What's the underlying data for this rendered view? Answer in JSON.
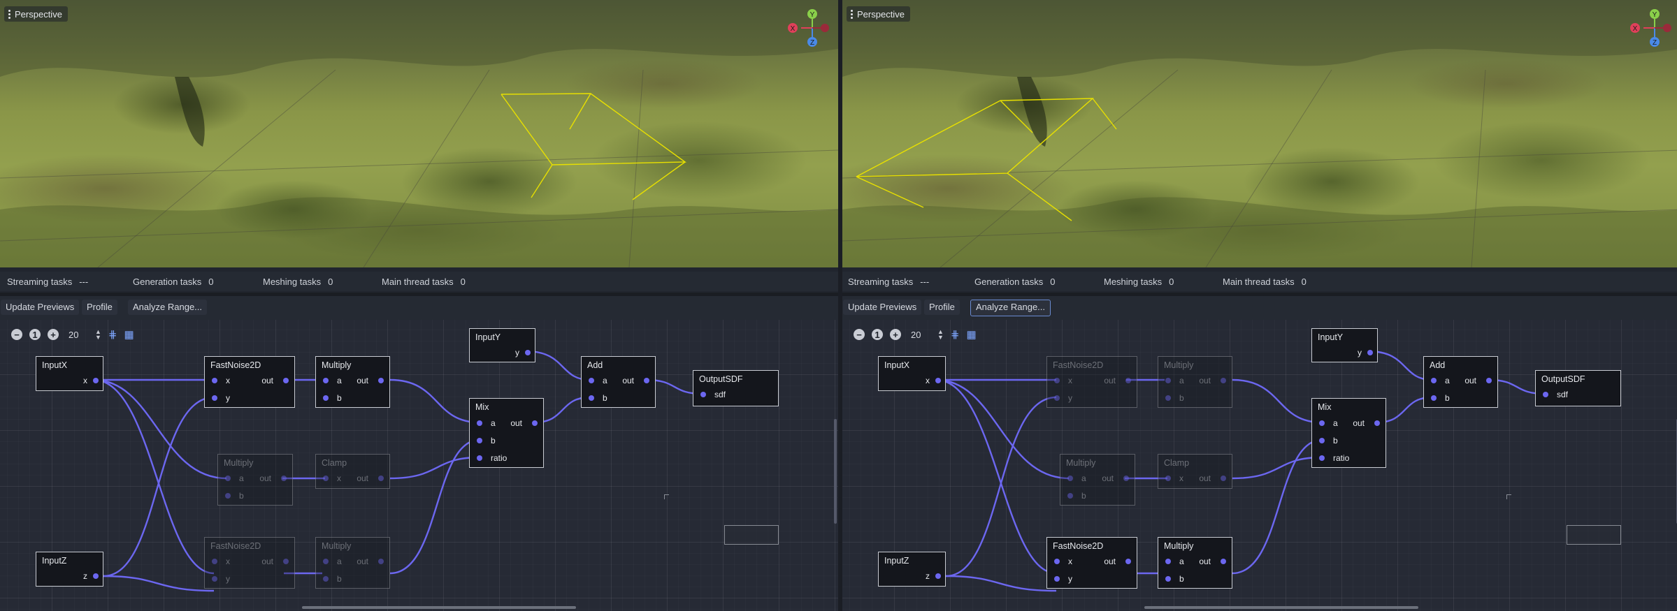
{
  "panels": [
    {
      "viewport": {
        "view_label": "Perspective",
        "gizmo": {
          "x": "X",
          "y": "Y",
          "z": "Z"
        }
      },
      "stats": [
        {
          "label": "Streaming tasks",
          "value": "---"
        },
        {
          "label": "Generation tasks",
          "value": "0"
        },
        {
          "label": "Meshing tasks",
          "value": "0"
        },
        {
          "label": "Main thread tasks",
          "value": "0"
        }
      ],
      "toolbar": {
        "update_previews": "Update Previews",
        "profile": "Profile",
        "analyze_range": "Analyze Range..."
      },
      "zoom": {
        "minus": "−",
        "one": "1",
        "plus": "+",
        "value": "20"
      },
      "nodes": {
        "inputx": {
          "title": "InputX",
          "out": "x"
        },
        "inputz": {
          "title": "InputZ",
          "out": "z"
        },
        "inputy": {
          "title": "InputY",
          "out": "y"
        },
        "noise1": {
          "title": "FastNoise2D",
          "in1": "x",
          "in2": "y",
          "out": "out"
        },
        "mul1": {
          "title": "Multiply",
          "in1": "a",
          "in2": "b",
          "out": "out"
        },
        "mul2": {
          "title": "Multiply",
          "in1": "a",
          "in2": "b",
          "out": "out"
        },
        "clamp": {
          "title": "Clamp",
          "in1": "x",
          "out": "out"
        },
        "noise2": {
          "title": "FastNoise2D",
          "in1": "x",
          "in2": "y",
          "out": "out"
        },
        "mul3": {
          "title": "Multiply",
          "in1": "a",
          "in2": "b",
          "out": "out"
        },
        "mix": {
          "title": "Mix",
          "in1": "a",
          "in2": "b",
          "in3": "ratio",
          "out": "out"
        },
        "add": {
          "title": "Add",
          "in1": "a",
          "in2": "b",
          "out": "out"
        },
        "output": {
          "title": "OutputSDF",
          "in1": "sdf"
        }
      }
    },
    {
      "viewport": {
        "view_label": "Perspective",
        "gizmo": {
          "x": "X",
          "y": "Y",
          "z": "Z"
        }
      },
      "stats": [
        {
          "label": "Streaming tasks",
          "value": "---"
        },
        {
          "label": "Generation tasks",
          "value": "0"
        },
        {
          "label": "Meshing tasks",
          "value": "0"
        },
        {
          "label": "Main thread tasks",
          "value": "0"
        }
      ],
      "toolbar": {
        "update_previews": "Update Previews",
        "profile": "Profile",
        "analyze_range": "Analyze Range..."
      },
      "zoom": {
        "minus": "−",
        "one": "1",
        "plus": "+",
        "value": "20"
      },
      "nodes": {
        "inputx": {
          "title": "InputX",
          "out": "x"
        },
        "inputz": {
          "title": "InputZ",
          "out": "z"
        },
        "inputy": {
          "title": "InputY",
          "out": "y"
        },
        "noise1": {
          "title": "FastNoise2D",
          "in1": "x",
          "in2": "y",
          "out": "out"
        },
        "mul1": {
          "title": "Multiply",
          "in1": "a",
          "in2": "b",
          "out": "out"
        },
        "mul2": {
          "title": "Multiply",
          "in1": "a",
          "in2": "b",
          "out": "out"
        },
        "clamp": {
          "title": "Clamp",
          "in1": "x",
          "out": "out"
        },
        "noise2": {
          "title": "FastNoise2D",
          "in1": "x",
          "in2": "y",
          "out": "out"
        },
        "mul3": {
          "title": "Multiply",
          "in1": "a",
          "in2": "b",
          "out": "out"
        },
        "mix": {
          "title": "Mix",
          "in1": "a",
          "in2": "b",
          "in3": "ratio",
          "out": "out"
        },
        "add": {
          "title": "Add",
          "in1": "a",
          "in2": "b",
          "out": "out"
        },
        "output": {
          "title": "OutputSDF",
          "in1": "sdf"
        }
      }
    }
  ],
  "colors": {
    "wire": "#6c67f0",
    "selection": "#e8e000",
    "accent": "#7ea6ff"
  }
}
